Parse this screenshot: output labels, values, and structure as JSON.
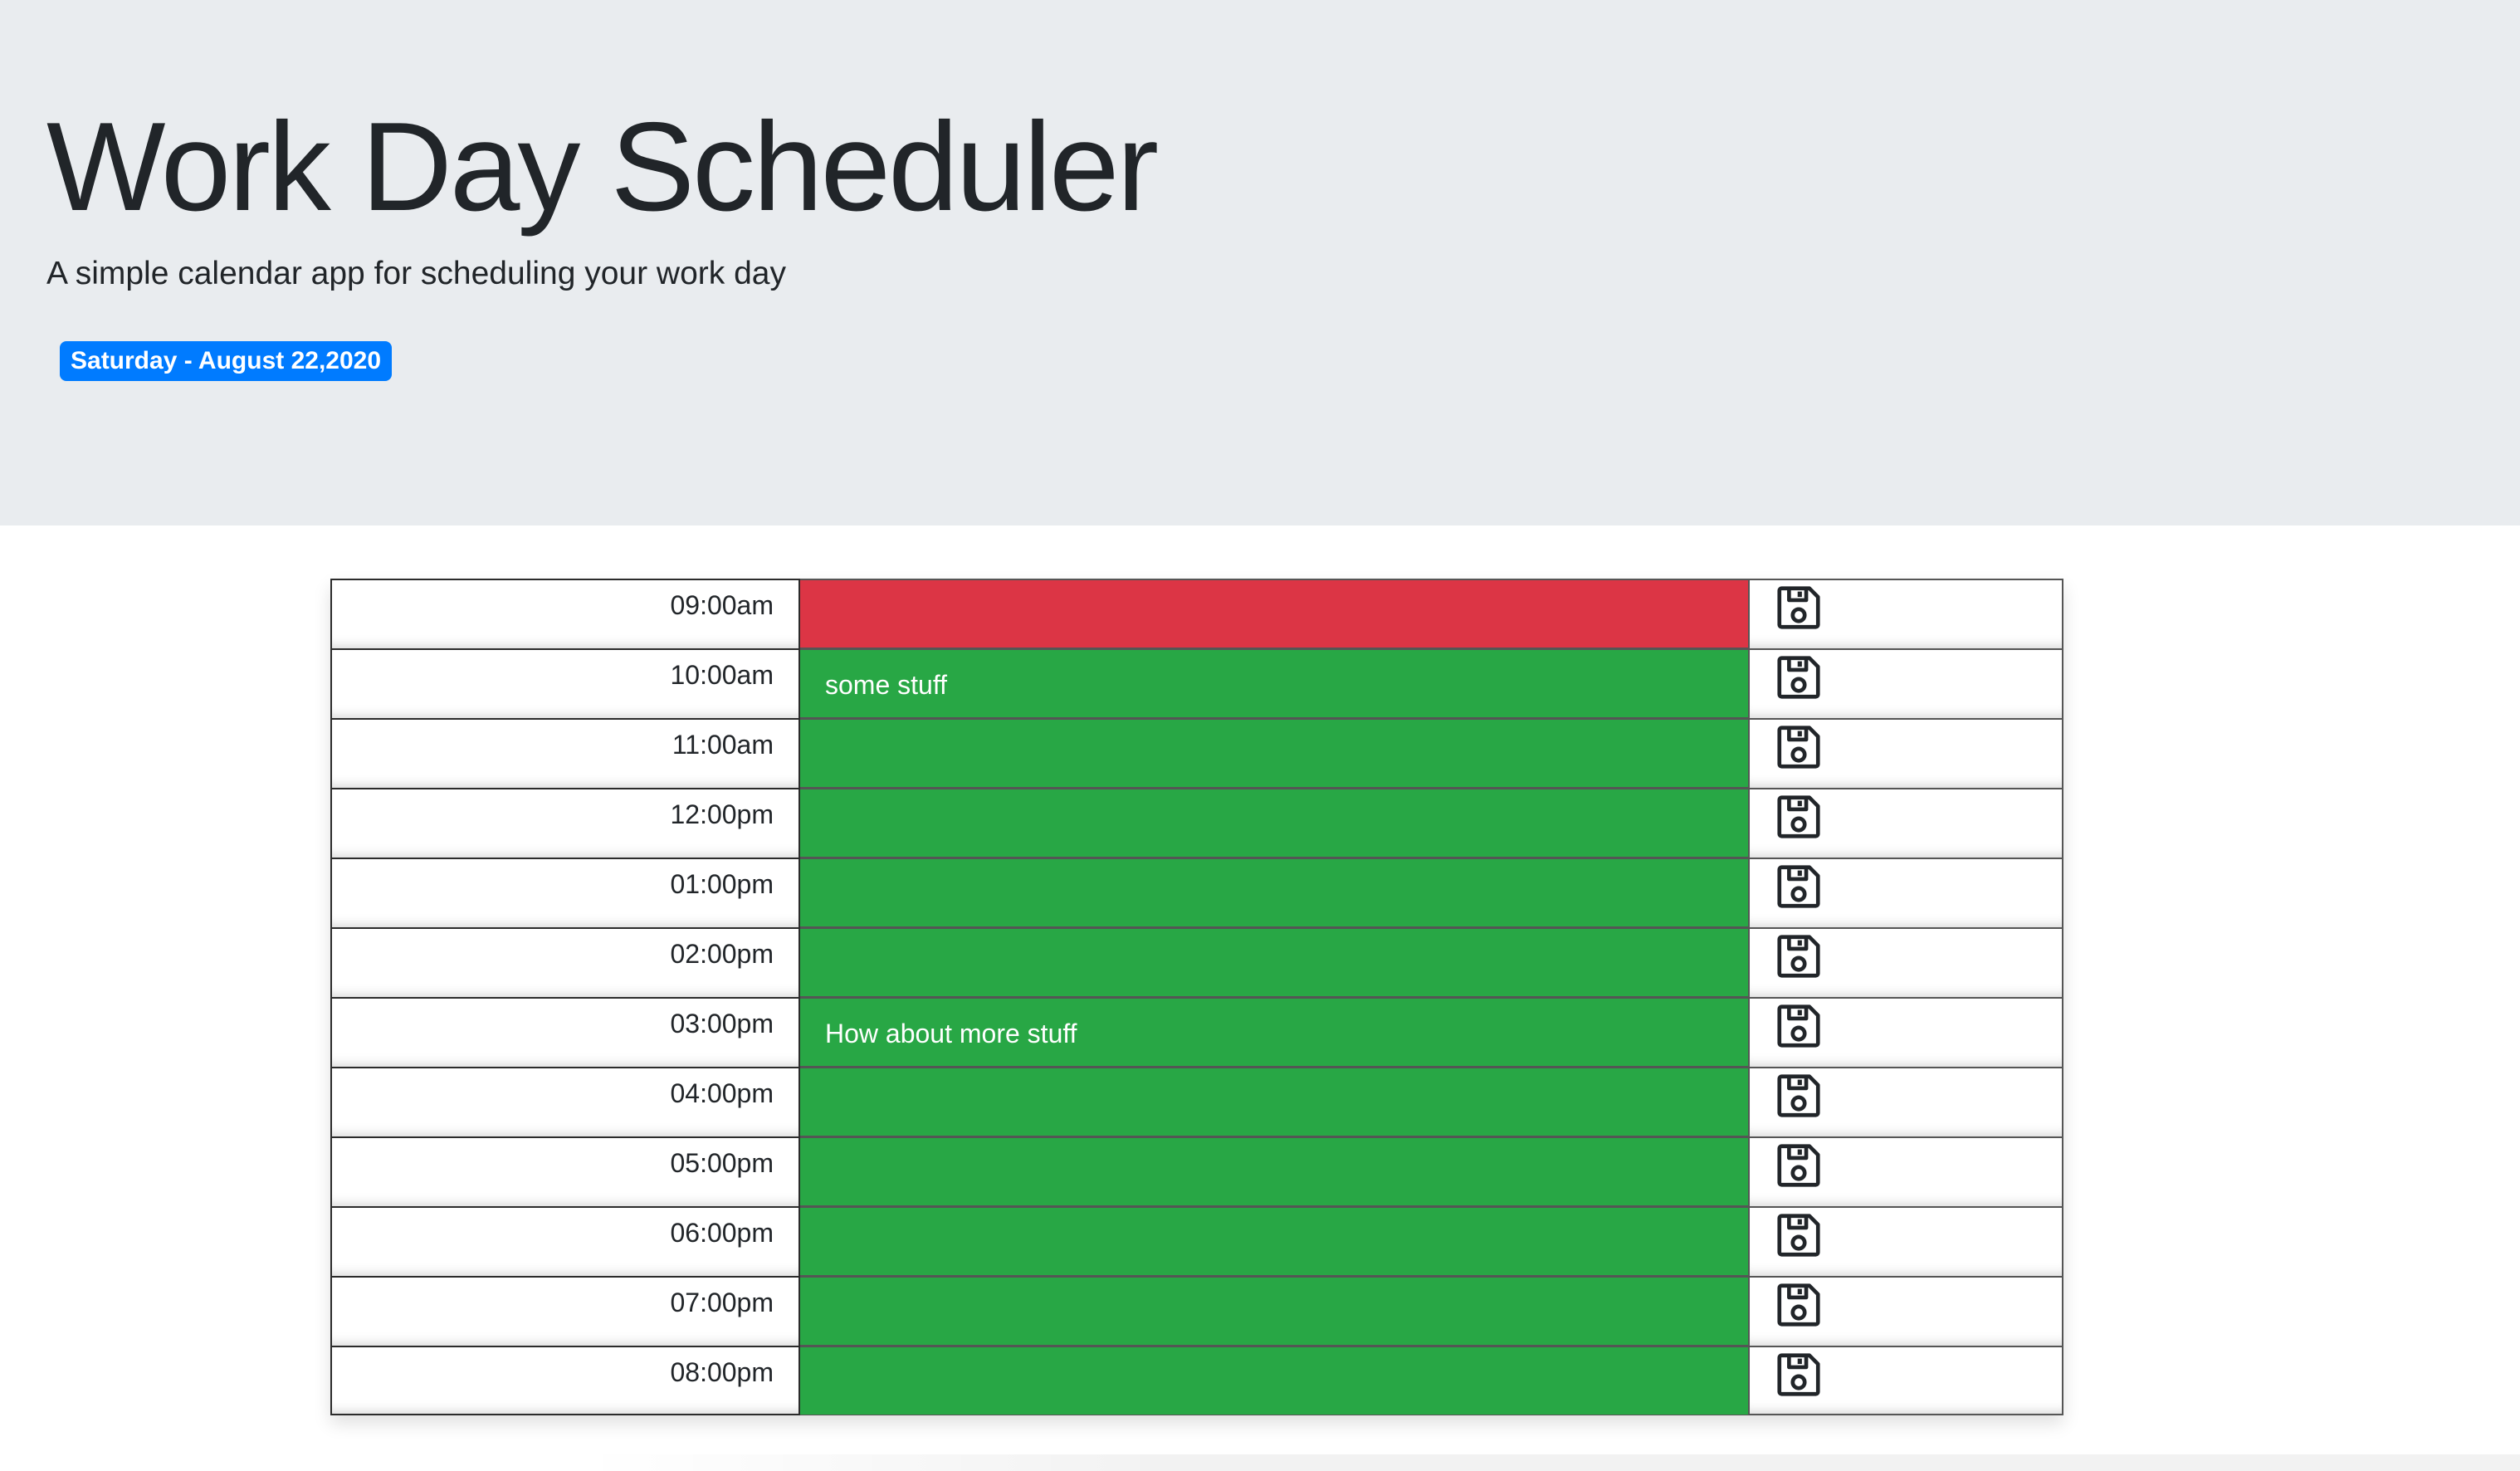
{
  "header": {
    "title": "Work Day Scheduler",
    "subtitle": "A simple calendar app for scheduling your work day",
    "date": "Saturday - August 22,2020"
  },
  "colors": {
    "header_bg": "#e9ecef",
    "badge_bg": "#007bff",
    "present": "#dc3545",
    "future": "#28a745"
  },
  "icons": {
    "save": "floppy-disk-icon"
  },
  "schedule": [
    {
      "hour": "09:00am",
      "text": "",
      "state": "present"
    },
    {
      "hour": "10:00am",
      "text": "some stuff",
      "state": "future"
    },
    {
      "hour": "11:00am",
      "text": "",
      "state": "future"
    },
    {
      "hour": "12:00pm",
      "text": "",
      "state": "future"
    },
    {
      "hour": "01:00pm",
      "text": "",
      "state": "future"
    },
    {
      "hour": "02:00pm",
      "text": "",
      "state": "future"
    },
    {
      "hour": "03:00pm",
      "text": "How about more stuff",
      "state": "future"
    },
    {
      "hour": "04:00pm",
      "text": "",
      "state": "future"
    },
    {
      "hour": "05:00pm",
      "text": "",
      "state": "future"
    },
    {
      "hour": "06:00pm",
      "text": "",
      "state": "future"
    },
    {
      "hour": "07:00pm",
      "text": "",
      "state": "future"
    },
    {
      "hour": "08:00pm",
      "text": "",
      "state": "future"
    }
  ]
}
